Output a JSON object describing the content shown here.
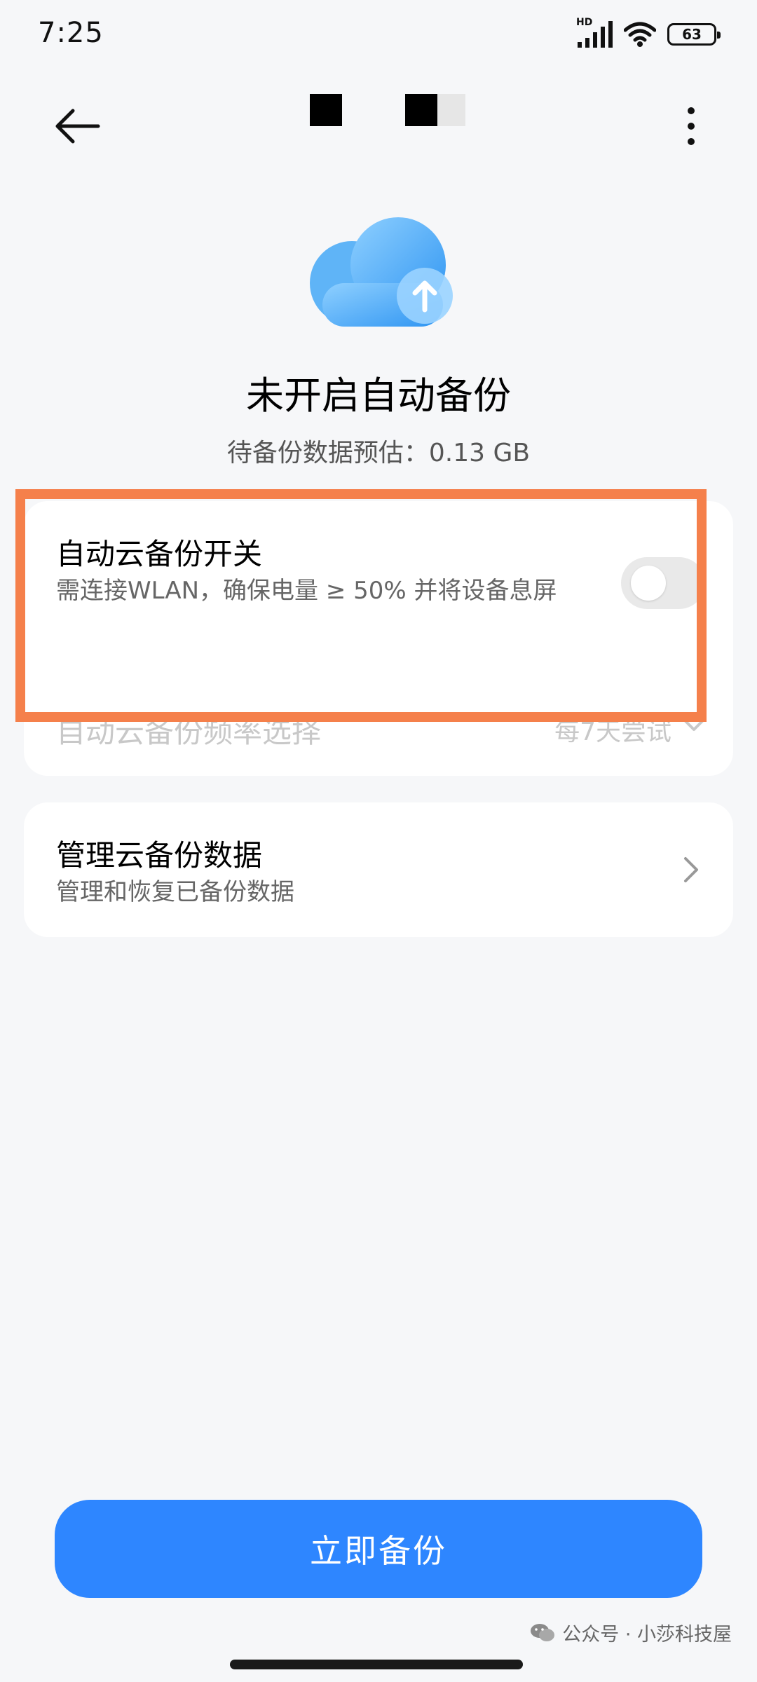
{
  "status_bar": {
    "time": "7:25",
    "network_label": "HD",
    "battery_level": "63"
  },
  "hero": {
    "title": "未开启自动备份",
    "subtitle": "待备份数据预估：0.13 GB"
  },
  "auto_backup": {
    "title": "自动云备份开关",
    "description": "需连接WLAN，确保电量 ≥ 50% 并将设备息屏",
    "enabled": false
  },
  "frequency": {
    "label": "自动云备份频率选择",
    "value": "每7天尝试"
  },
  "manage": {
    "title": "管理云备份数据",
    "description": "管理和恢复已备份数据"
  },
  "actions": {
    "backup_now_label": "立即备份"
  },
  "watermark": {
    "text": "公众号 · 小莎科技屋"
  },
  "colors": {
    "background": "#f6f7f9",
    "accent": "#2e86ff",
    "highlight": "#f5804b",
    "cloud_light": "#7cc2ff",
    "cloud_main": "#3a9ef5"
  },
  "icons": {
    "back": "arrow-left-icon",
    "more": "more-vertical-icon",
    "cloud": "cloud-upload-icon",
    "chevron_right": "chevron-right-icon",
    "chevron_down": "chevron-down-icon"
  }
}
